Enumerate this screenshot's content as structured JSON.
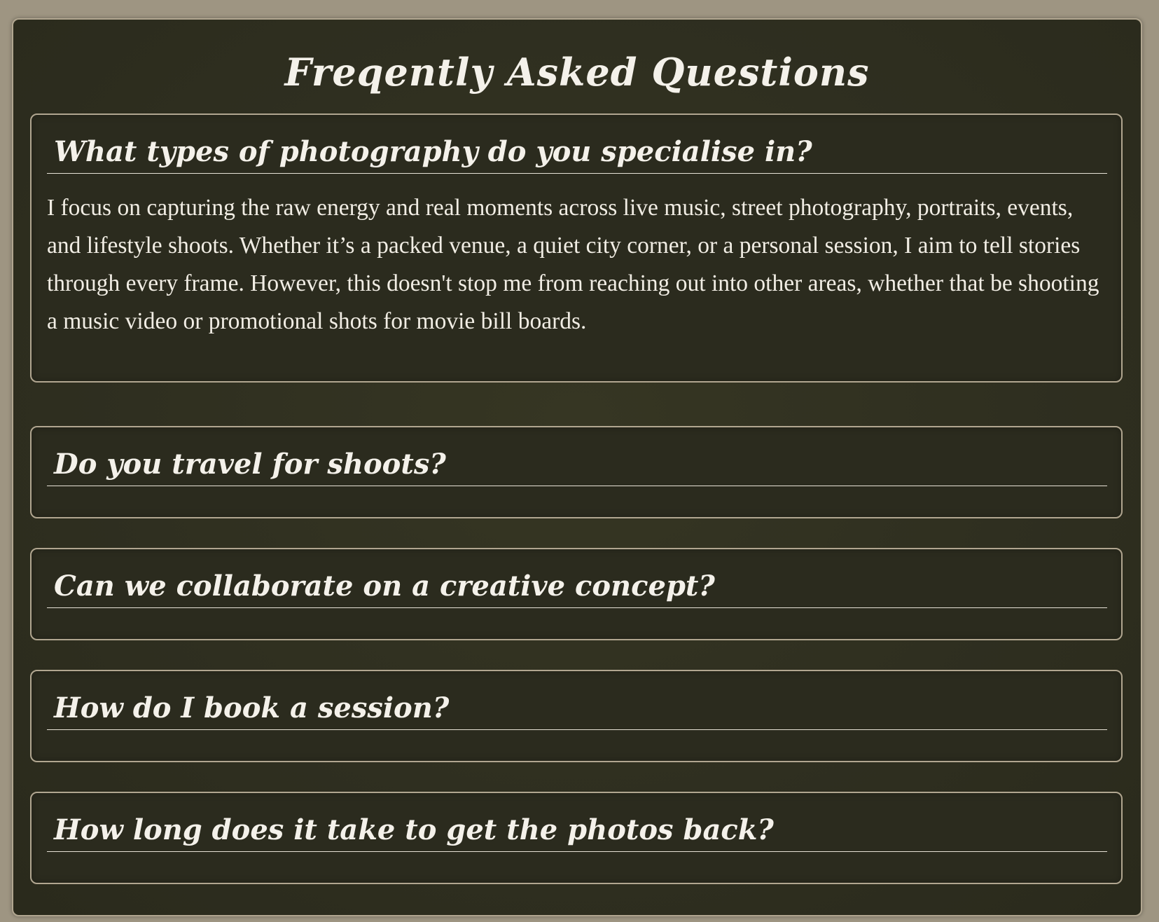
{
  "page": {
    "title": "Freqently Asked Questions"
  },
  "faq": [
    {
      "question": "What types of photography do you specialise in?",
      "answer": "I focus on capturing the raw energy and real moments across live music, street photography, portraits, events, and lifestyle shoots. Whether it’s a packed venue, a quiet city corner, or a personal session, I aim to tell stories through every frame. However, this doesn't stop me from reaching out into other areas, whether that be shooting a music video or promotional shots for movie bill boards."
    },
    {
      "question": "Do you travel for shoots?"
    },
    {
      "question": "Can we collaborate on a creative concept?"
    },
    {
      "question": "How do I book a session?"
    },
    {
      "question": "How long does it take to get the photos back?"
    }
  ],
  "colors": {
    "page_background": "#9e9582",
    "panel_background": "#2f2f20",
    "border": "#b1a690",
    "text": "#f4f1ea"
  }
}
